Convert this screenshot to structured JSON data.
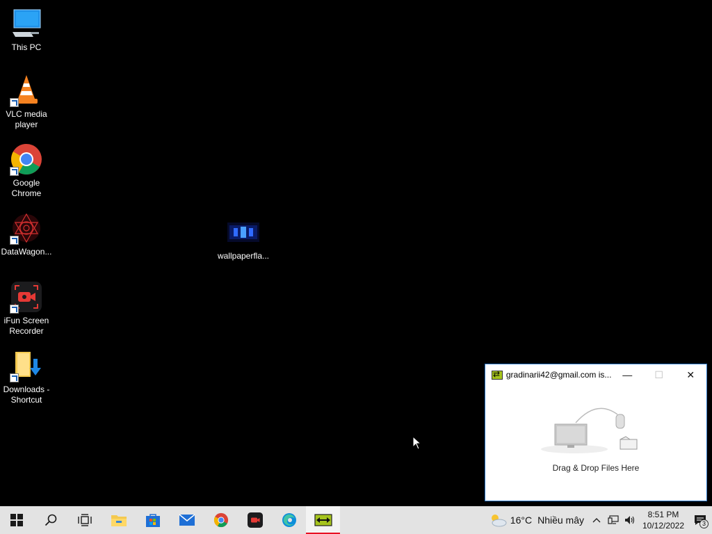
{
  "desktop": {
    "icons": [
      {
        "name": "this-pc",
        "label": "This PC"
      },
      {
        "name": "vlc",
        "label": "VLC media\nplayer"
      },
      {
        "name": "chrome",
        "label": "Google\nChrome"
      },
      {
        "name": "datawagon",
        "label": "DataWagon..."
      },
      {
        "name": "ifun",
        "label": "iFun Screen\nRecorder"
      },
      {
        "name": "downloads",
        "label": "Downloads -\nShortcut"
      },
      {
        "name": "wallpaper",
        "label": "wallpaperfla..."
      }
    ]
  },
  "ft_window": {
    "title": "gradinarii42@gmail.com is...",
    "minimize": "—",
    "maximize": "☐",
    "close": "✕",
    "drop_text": "Drag & Drop Files Here"
  },
  "taskbar": {
    "items": [
      {
        "name": "start",
        "icon": "windows-icon"
      },
      {
        "name": "search",
        "icon": "search-icon"
      },
      {
        "name": "task-view",
        "icon": "task-view-icon"
      },
      {
        "name": "file-explorer",
        "icon": "folder-icon"
      },
      {
        "name": "store",
        "icon": "store-icon"
      },
      {
        "name": "mail",
        "icon": "mail-icon"
      },
      {
        "name": "chrome",
        "icon": "chrome-icon"
      },
      {
        "name": "ifun",
        "icon": "ifun-icon"
      },
      {
        "name": "edge",
        "icon": "edge-icon"
      },
      {
        "name": "file-transfer",
        "icon": "file-transfer-icon",
        "active": true
      }
    ],
    "weather": {
      "temp": "16°C",
      "condition": "Nhiều mây"
    },
    "clock": {
      "time": "8:51 PM",
      "date": "10/12/2022"
    },
    "notifications": {
      "count": "3"
    }
  },
  "colors": {
    "accent": "#e81123",
    "window_border": "#2b78c9",
    "taskbar": "#e3e3e3",
    "desktop": "#000000"
  }
}
